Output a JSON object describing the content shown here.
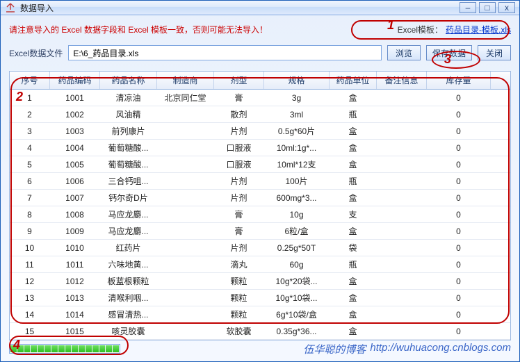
{
  "window": {
    "title": "数据导入"
  },
  "top": {
    "warning": "请注意导入的 Excel 数据字段和 Excel 模板一致，否则可能无法导入！",
    "template_label": "Excel模板：",
    "template_link": "药品目录-模板.xls"
  },
  "file": {
    "label": "Excel数据文件",
    "value": "E:\\6_药品目录.xls",
    "browse": "浏览",
    "save": "保存数据",
    "close": "关闭"
  },
  "columns": [
    "序号",
    "药品编码",
    "药品名称",
    "制造商",
    "剂型",
    "规格",
    "药品单位",
    "备注信息",
    "库存量"
  ],
  "rows": [
    {
      "idx": "1",
      "code": "1001",
      "name": "清凉油",
      "maker": "北京同仁堂",
      "form": "膏",
      "spec": "3g",
      "unit": "盒",
      "note": "",
      "stock": "0"
    },
    {
      "idx": "2",
      "code": "1002",
      "name": "风油精",
      "maker": "",
      "form": "散剂",
      "spec": "3ml",
      "unit": "瓶",
      "note": "",
      "stock": "0"
    },
    {
      "idx": "3",
      "code": "1003",
      "name": "前列康片",
      "maker": "",
      "form": "片剂",
      "spec": "0.5g*60片",
      "unit": "盒",
      "note": "",
      "stock": "0"
    },
    {
      "idx": "4",
      "code": "1004",
      "name": "葡萄糖酸...",
      "maker": "",
      "form": "口服液",
      "spec": "10ml:1g*...",
      "unit": "盒",
      "note": "",
      "stock": "0"
    },
    {
      "idx": "5",
      "code": "1005",
      "name": "葡萄糖酸...",
      "maker": "",
      "form": "口服液",
      "spec": "10ml*12支",
      "unit": "盒",
      "note": "",
      "stock": "0"
    },
    {
      "idx": "6",
      "code": "1006",
      "name": "三合钙咀...",
      "maker": "",
      "form": "片剂",
      "spec": "100片",
      "unit": "瓶",
      "note": "",
      "stock": "0"
    },
    {
      "idx": "7",
      "code": "1007",
      "name": "钙尔奇D片",
      "maker": "",
      "form": "片剂",
      "spec": "600mg*3...",
      "unit": "盒",
      "note": "",
      "stock": "0"
    },
    {
      "idx": "8",
      "code": "1008",
      "name": "马应龙麝...",
      "maker": "",
      "form": "膏",
      "spec": "10g",
      "unit": "支",
      "note": "",
      "stock": "0"
    },
    {
      "idx": "9",
      "code": "1009",
      "name": "马应龙麝...",
      "maker": "",
      "form": "膏",
      "spec": "6粒/盒",
      "unit": "盒",
      "note": "",
      "stock": "0"
    },
    {
      "idx": "10",
      "code": "1010",
      "name": "红药片",
      "maker": "",
      "form": "片剂",
      "spec": "0.25g*50T",
      "unit": "袋",
      "note": "",
      "stock": "0"
    },
    {
      "idx": "11",
      "code": "1011",
      "name": "六味地黄...",
      "maker": "",
      "form": "滴丸",
      "spec": "60g",
      "unit": "瓶",
      "note": "",
      "stock": "0"
    },
    {
      "idx": "12",
      "code": "1012",
      "name": "板蓝根颗粒",
      "maker": "",
      "form": "颗粒",
      "spec": "10g*20袋...",
      "unit": "盒",
      "note": "",
      "stock": "0"
    },
    {
      "idx": "13",
      "code": "1013",
      "name": "清喉利咽...",
      "maker": "",
      "form": "颗粒",
      "spec": "10g*10袋...",
      "unit": "盒",
      "note": "",
      "stock": "0"
    },
    {
      "idx": "14",
      "code": "1014",
      "name": "感冒清热...",
      "maker": "",
      "form": "颗粒",
      "spec": "6g*10袋/盒",
      "unit": "盒",
      "note": "",
      "stock": "0"
    },
    {
      "idx": "15",
      "code": "1015",
      "name": "咳灵胶囊",
      "maker": "",
      "form": "软胶囊",
      "spec": "0.35g*36...",
      "unit": "盒",
      "note": "",
      "stock": "0"
    }
  ],
  "annotations": {
    "n1": "1",
    "n2": "2",
    "n3": "3",
    "n4": "4"
  },
  "footer": {
    "blog_name": "伍华聪的博客",
    "blog_url": "http://wuhuacong.cnblogs.com"
  }
}
